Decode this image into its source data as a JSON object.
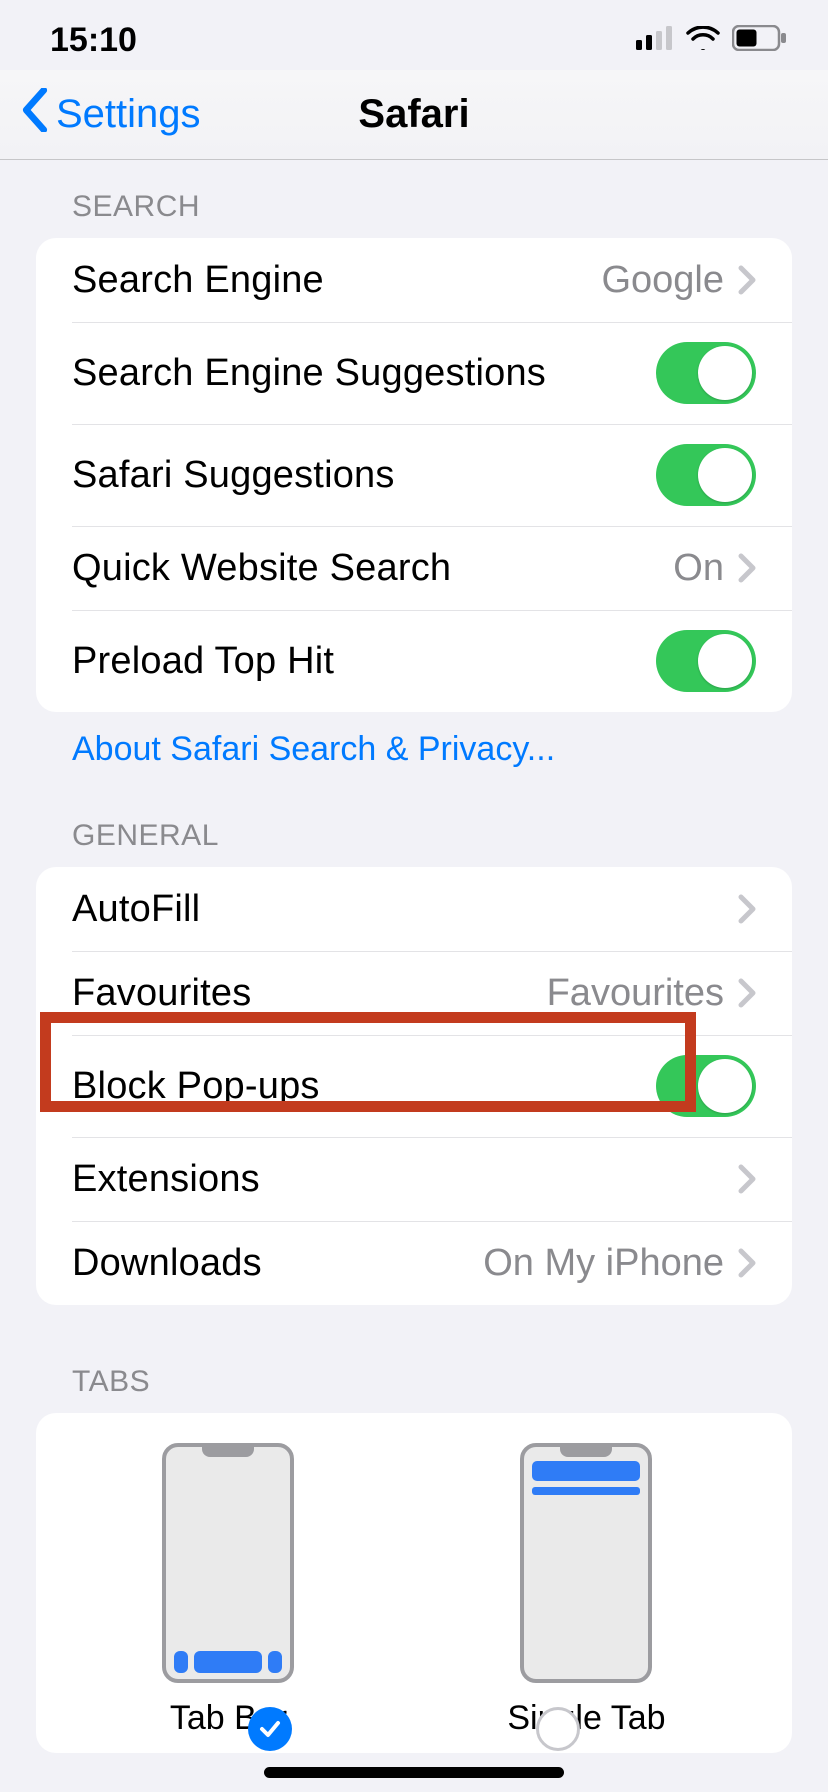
{
  "status": {
    "time": "15:10"
  },
  "nav": {
    "back": "Settings",
    "title": "Safari"
  },
  "sections": {
    "search": {
      "header": "SEARCH",
      "search_engine": {
        "label": "Search Engine",
        "value": "Google"
      },
      "search_engine_suggestions": {
        "label": "Search Engine Suggestions"
      },
      "safari_suggestions": {
        "label": "Safari Suggestions"
      },
      "quick_website_search": {
        "label": "Quick Website Search",
        "value": "On"
      },
      "preload_top_hit": {
        "label": "Preload Top Hit"
      },
      "footer_link": "About Safari Search & Privacy..."
    },
    "general": {
      "header": "GENERAL",
      "autofill": {
        "label": "AutoFill"
      },
      "favourites": {
        "label": "Favourites",
        "value": "Favourites"
      },
      "block_popups": {
        "label": "Block Pop-ups"
      },
      "extensions": {
        "label": "Extensions"
      },
      "downloads": {
        "label": "Downloads",
        "value": "On My iPhone"
      }
    },
    "tabs": {
      "header": "TABS",
      "tab_bar": "Tab Bar",
      "single_tab": "Single Tab"
    }
  }
}
